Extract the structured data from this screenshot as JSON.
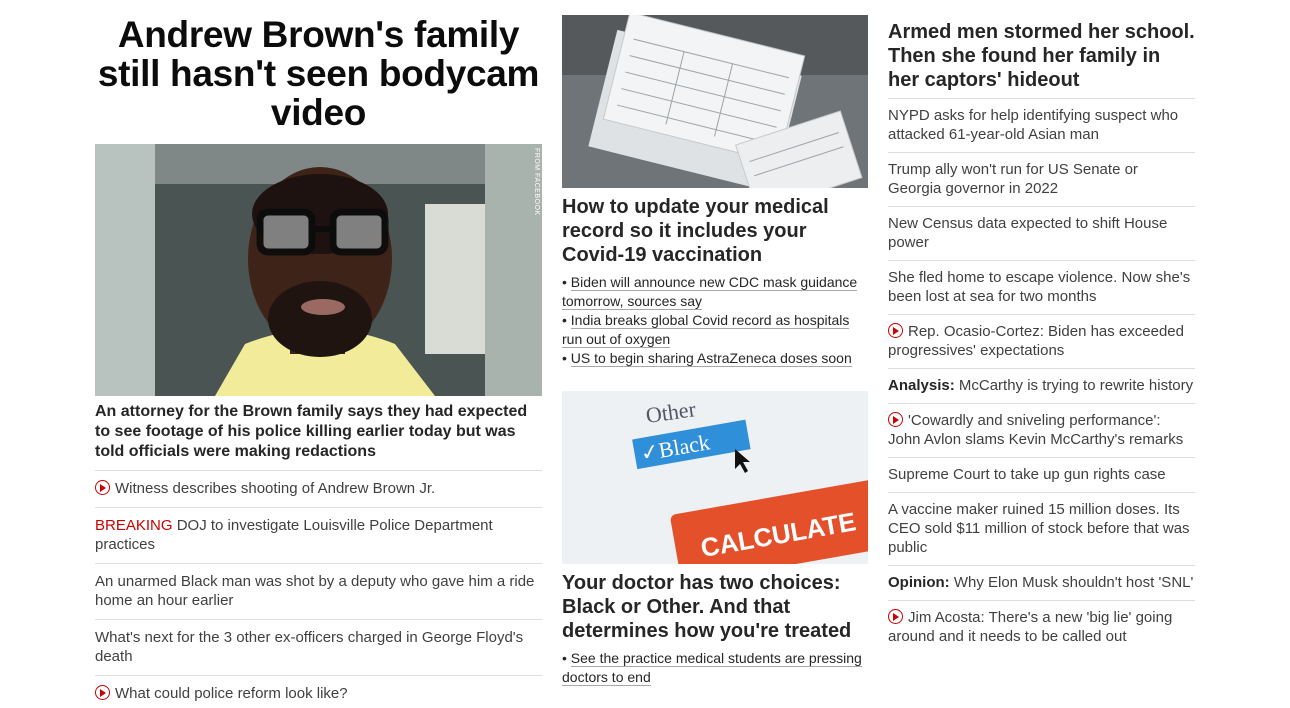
{
  "left": {
    "headline": "Andrew Brown's family still hasn't seen bodycam video",
    "image_credit": "FROM FACEBOOK",
    "subhead": "An attorney for the Brown family says they had expected to see footage of his police killing earlier today but was told officials were making redactions",
    "items": [
      {
        "text": "Witness describes shooting of Andrew Brown Jr.",
        "video": true
      },
      {
        "prefix": "BREAKING",
        "text": " DOJ to investigate Louisville Police Department practices"
      },
      {
        "text": "An unarmed Black man was shot by a deputy who gave him a ride home an hour earlier"
      },
      {
        "text": "What's next for the 3 other ex-officers charged in George Floyd's death"
      },
      {
        "text": "What could police reform look like?",
        "video": true
      }
    ]
  },
  "middle": {
    "card1": {
      "title": "How to update your medical record so it includes your Covid-19 vaccination",
      "bullets": [
        "Biden will announce new CDC mask guidance tomorrow, sources say",
        "India breaks global Covid record as hospitals run out of oxygen",
        "US to begin sharing AstraZeneca doses soon"
      ]
    },
    "card2": {
      "image_text": {
        "other": "Other",
        "black": "✓Black",
        "calculate": "CALCULATE"
      },
      "title": "Your doctor has two choices: Black or Other. And that determines how you're treated",
      "bullets": [
        "See the practice medical students are pressing doctors to end"
      ]
    }
  },
  "right": {
    "headline": "Armed men stormed her school. Then she found her family in her captors' hideout",
    "items": [
      {
        "text": "NYPD asks for help identifying suspect who attacked 61-year-old Asian man"
      },
      {
        "text": "Trump ally won't run for US Senate or Georgia governor in 2022"
      },
      {
        "text": "New Census data expected to shift House power"
      },
      {
        "text": "She fled home to escape violence. Now she's been lost at sea for two months"
      },
      {
        "text": "Rep. Ocasio-Cortez: Biden has exceeded progressives' expectations",
        "video": true
      },
      {
        "label": "Analysis:",
        "text": " McCarthy is trying to rewrite history"
      },
      {
        "text": "'Cowardly and sniveling performance': John Avlon slams Kevin McCarthy's remarks",
        "video": true
      },
      {
        "text": "Supreme Court to take up gun rights case"
      },
      {
        "text": "A vaccine maker ruined 15 million doses. Its CEO sold $11 million of stock before that was public"
      },
      {
        "label": "Opinion:",
        "text": " Why Elon Musk shouldn't host 'SNL'"
      },
      {
        "text": "Jim Acosta: There's a new 'big lie' going around and it needs to be called out",
        "video": true
      }
    ]
  },
  "colors": {
    "accent_red": "#cc0000",
    "text": "#262626",
    "divider": "#dddddd"
  }
}
